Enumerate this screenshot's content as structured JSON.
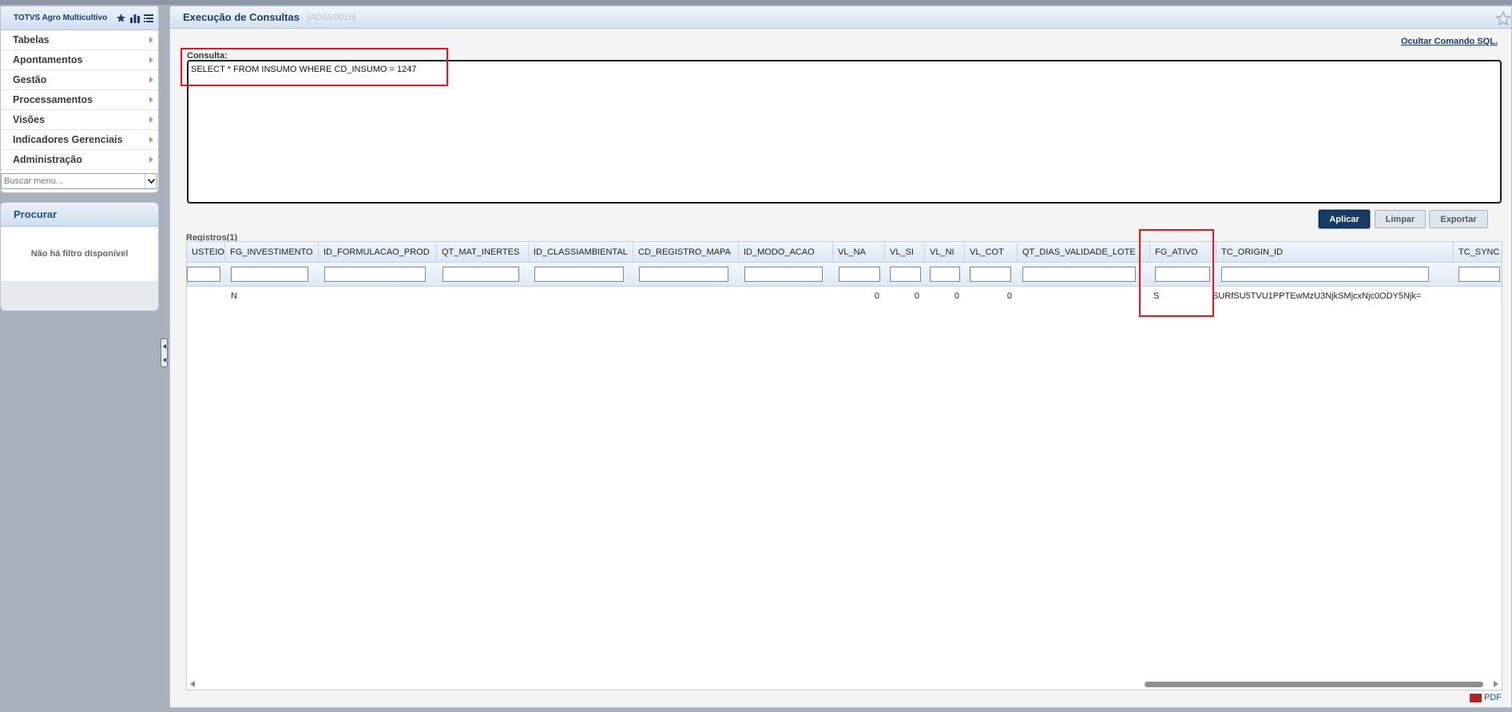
{
  "app": {
    "title": "TOTVS Agro Multicultivo"
  },
  "sidebar": {
    "menu": [
      {
        "label": "Tabelas"
      },
      {
        "label": "Apontamentos"
      },
      {
        "label": "Gestão"
      },
      {
        "label": "Processamentos"
      },
      {
        "label": "Visões"
      },
      {
        "label": "Indicadores Gerenciais"
      },
      {
        "label": "Administração"
      }
    ],
    "search_placeholder": "Buscar menu...",
    "procurar": {
      "title": "Procurar",
      "empty_text": "Não há filtro disponível"
    }
  },
  "page": {
    "title": "Execução de Consultas",
    "code": "[ADSV0016]",
    "hide_sql_link": "Ocultar Comando SQL.",
    "consulta_label": "Consulta:",
    "sql_text": "SELECT * FROM INSUMO WHERE CD_INSUMO = 1247",
    "buttons": {
      "apply": "Aplicar",
      "clear": "Limpar",
      "export": "Exportar"
    },
    "registros_label": "Registros(1)",
    "pdf_label": "PDF"
  },
  "grid": {
    "columns": [
      "USTEIO",
      "FG_INVESTIMENTO",
      "ID_FORMULACAO_PROD",
      "QT_MAT_INERTES",
      "ID_CLASSIAMBIENTAL",
      "CD_REGISTRO_MAPA",
      "ID_MODO_ACAO",
      "VL_NA",
      "VL_SI",
      "VL_NI",
      "VL_COT",
      "QT_DIAS_VALIDADE_LOTE",
      "FG_ATIVO",
      "TC_ORIGIN_ID",
      "TC_SYNC"
    ],
    "rows": [
      [
        "",
        "N",
        "",
        "",
        "",
        "",
        "",
        "0",
        "0",
        "0",
        "0",
        "",
        "S",
        "SURfSU5TVU1PPTEwMzU3NjkSMjcxNjc0ODY5Njk=",
        ""
      ]
    ]
  }
}
